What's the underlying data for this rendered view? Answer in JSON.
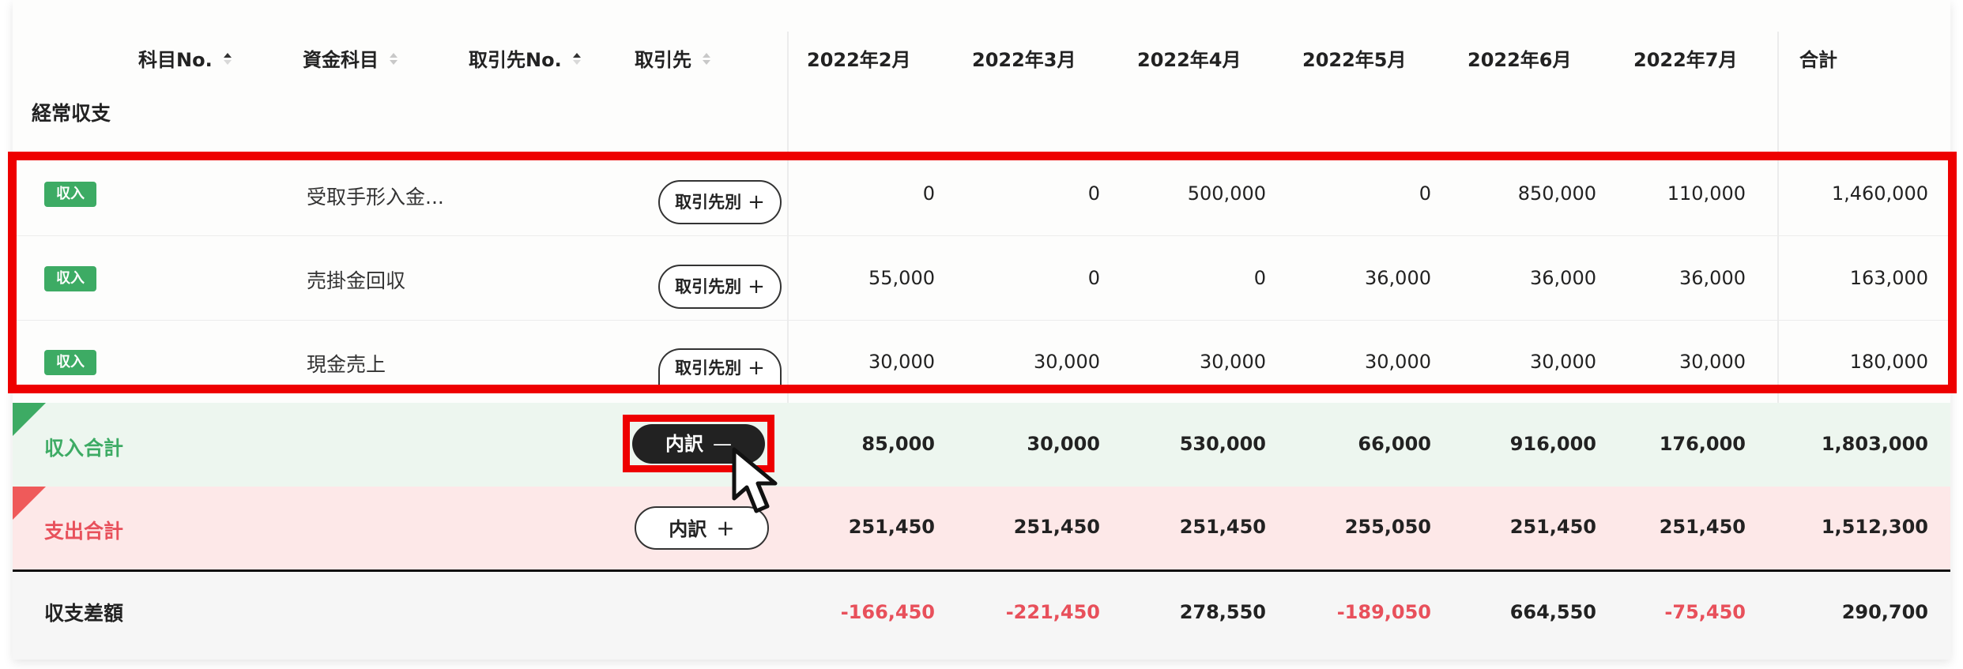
{
  "header": {
    "account_no": "科目No.",
    "account": "資金科目",
    "partner_no": "取引先No.",
    "partner": "取引先",
    "months": [
      "2022年2月",
      "2022年3月",
      "2022年4月",
      "2022年5月",
      "2022年6月",
      "2022年7月"
    ],
    "total": "合計"
  },
  "section": {
    "label": "経常収支"
  },
  "rows": [
    {
      "badge": "収入",
      "account": "受取手形入金...",
      "button": "取引先別",
      "button_icon": "+",
      "values": [
        "0",
        "0",
        "500,000",
        "0",
        "850,000",
        "110,000"
      ],
      "total": "1,460,000"
    },
    {
      "badge": "収入",
      "account": "売掛金回収",
      "button": "取引先別",
      "button_icon": "+",
      "values": [
        "55,000",
        "0",
        "0",
        "36,000",
        "36,000",
        "36,000"
      ],
      "total": "163,000"
    },
    {
      "badge": "収入",
      "account": "現金売上",
      "button": "取引先別",
      "button_icon": "+",
      "values": [
        "30,000",
        "30,000",
        "30,000",
        "30,000",
        "30,000",
        "30,000"
      ],
      "total": "180,000"
    }
  ],
  "income_total": {
    "label": "収入合計",
    "button": "内訳",
    "button_icon": "—",
    "values": [
      "85,000",
      "30,000",
      "530,000",
      "66,000",
      "916,000",
      "176,000"
    ],
    "total": "1,803,000"
  },
  "expense_total": {
    "label": "支出合計",
    "button": "内訳",
    "button_icon": "+",
    "values": [
      "251,450",
      "251,450",
      "251,450",
      "255,050",
      "251,450",
      "251,450"
    ],
    "total": "1,512,300"
  },
  "balance": {
    "label": "収支差額",
    "values": [
      "-166,450",
      "-221,450",
      "278,550",
      "-189,050",
      "664,550",
      "-75,450"
    ],
    "total": "290,700"
  },
  "colors": {
    "income_green": "#3dab64",
    "expense_red": "#ef5a5a",
    "negative_red": "#e8505b",
    "highlight_red": "#ee0000",
    "income_row_bg": "#edf6ef",
    "expense_row_bg": "#fde8e8"
  },
  "icons": {
    "sort": "sort-arrows-icon",
    "cursor": "mouse-pointer-icon",
    "expand": "plus-icon",
    "collapse": "minus-icon"
  }
}
